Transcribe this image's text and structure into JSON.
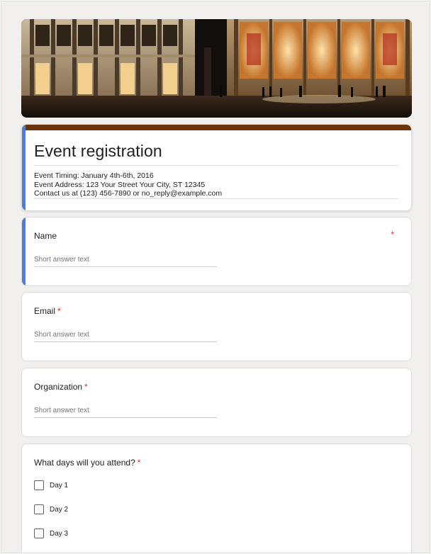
{
  "form": {
    "title": "Event registration",
    "description": [
      "Event Timing: January 4th-6th, 2016",
      "Event Address: 123 Your Street Your City, ST 12345",
      "Contact us at (123) 456-7890 or no_reply@example.com"
    ],
    "accent_color": "#6b3510",
    "focus_color": "#4a7fd8",
    "required_mark": "*"
  },
  "questions": [
    {
      "label": "Name",
      "placeholder": "Short answer text"
    },
    {
      "label": "Email",
      "placeholder": "Short answer text"
    },
    {
      "label": "Organization",
      "placeholder": "Short answer text"
    }
  ],
  "days_question": {
    "label": "What days will you attend?",
    "options": [
      "Day 1",
      "Day 2",
      "Day 3"
    ]
  }
}
